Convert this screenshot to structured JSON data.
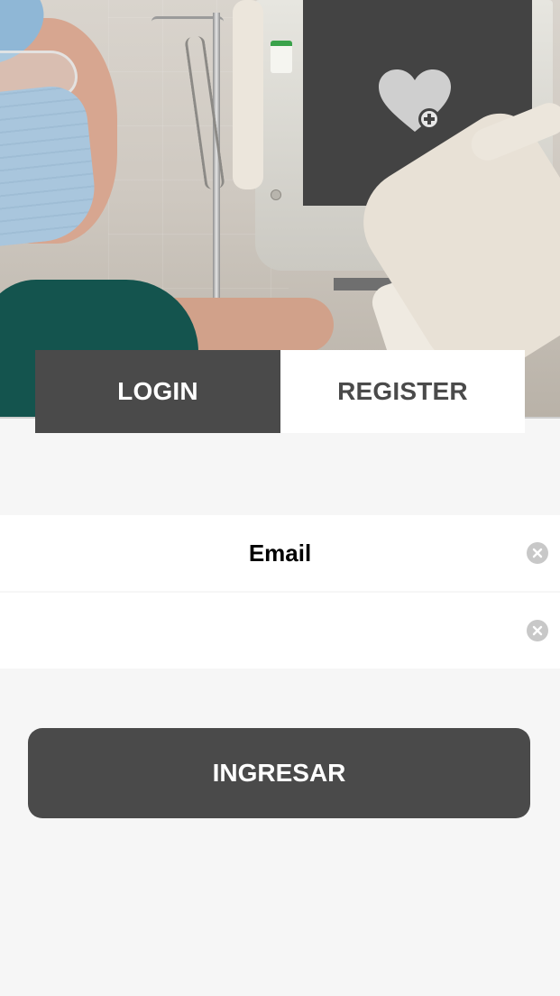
{
  "tabs": {
    "login_label": "LOGIN",
    "register_label": "REGISTER",
    "active": "LOGIN"
  },
  "form": {
    "email": {
      "placeholder": "Email",
      "value": ""
    },
    "password": {
      "placeholder": "",
      "value": ""
    },
    "submit_label": "INGRESAR"
  },
  "icons": {
    "logo": "heart-plus-icon",
    "clear": "clear-circle-icon"
  },
  "colors": {
    "dark": "#4a4a4a",
    "light_bg": "#f6f6f6",
    "white": "#ffffff",
    "clear_icon": "#c8c8c8"
  }
}
